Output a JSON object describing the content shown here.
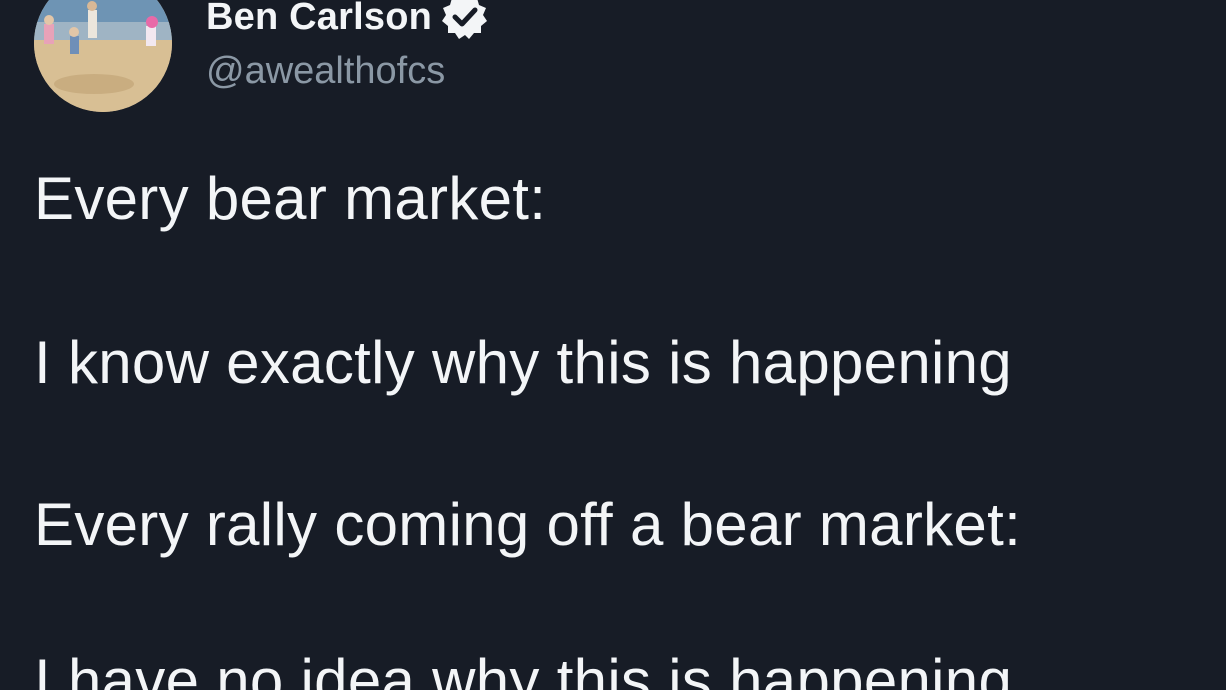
{
  "author": {
    "display_name": "Ben Carlson",
    "handle": "@awealthofcs",
    "verified": true,
    "verified_icon": "verified-badge-icon",
    "avatar": "beach-photo-avatar"
  },
  "tweet": {
    "lines": [
      "Every bear market:",
      "I know exactly why this is happening",
      "Every rally coming off a bear market:",
      "I have no idea why this is happening"
    ]
  },
  "colors": {
    "background": "#171c26",
    "text": "#f3f5f7",
    "secondary_text": "#8b98a5"
  }
}
